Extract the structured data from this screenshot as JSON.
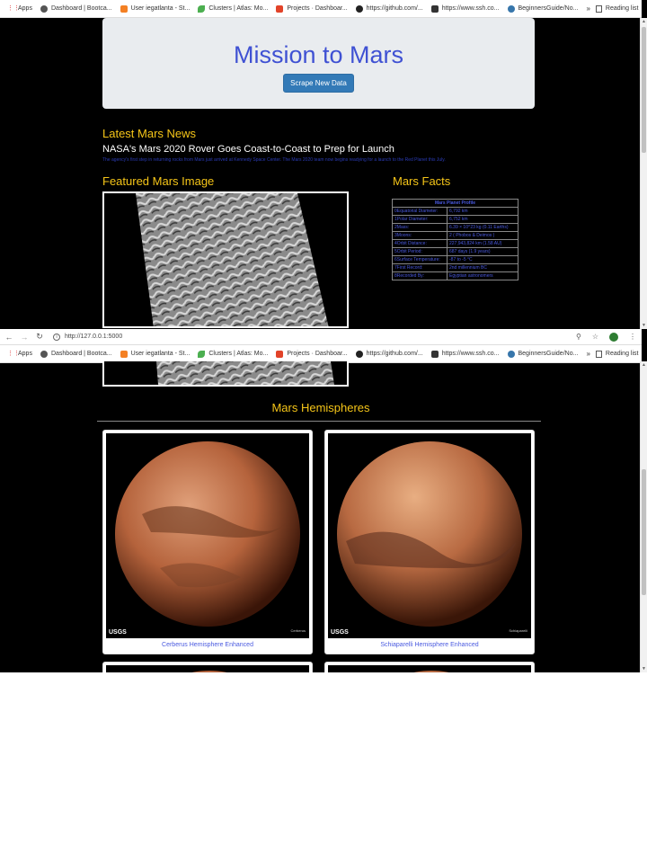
{
  "bookmarks": {
    "items": [
      {
        "label": "Apps",
        "icon": "apps-grid-icon"
      },
      {
        "label": "Dashboard | Bootca...",
        "icon": "globe-icon"
      },
      {
        "label": "User iegatlanta - St...",
        "icon": "stackoverflow-icon"
      },
      {
        "label": "Clusters | Atlas: Mo...",
        "icon": "mongodb-leaf-icon"
      },
      {
        "label": "Projects · Dashboar...",
        "icon": "gitlab-icon"
      },
      {
        "label": "https://github.com/...",
        "icon": "github-icon"
      },
      {
        "label": "https://www.ssh.co...",
        "icon": "ssh-icon"
      },
      {
        "label": "BeginnersGuide/No...",
        "icon": "python-icon"
      }
    ],
    "more": "»",
    "reading_list": "Reading list"
  },
  "address_bar": {
    "url": "http://127.0.0.1:5000"
  },
  "page": {
    "title": "Mission to Mars",
    "scrape_button": "Scrape New Data",
    "news_heading": "Latest Mars News",
    "news_title": "NASA's Mars 2020 Rover Goes Coast-to-Coast to Prep for Launch",
    "news_paragraph": "The agency's first step in returning rocks from Mars just arrived at Kennedy Space Center. The Mars 2020 team now begins readying for a launch to the Red Planet this July.",
    "featured_heading": "Featured Mars Image",
    "facts_heading": "Mars Facts",
    "facts": {
      "header": "Mars Planet Profile",
      "rows": [
        {
          "idx": "0",
          "key": "Equatorial Diameter:",
          "value": "6,792 km"
        },
        {
          "idx": "1",
          "key": "Polar Diameter:",
          "value": "6,752 km"
        },
        {
          "idx": "2",
          "key": "Mass:",
          "value": "6.39 × 10^23 kg (0.11 Earths)"
        },
        {
          "idx": "3",
          "key": "Moons:",
          "value": "2 ( Phobos & Deimos )"
        },
        {
          "idx": "4",
          "key": "Orbit Distance:",
          "value": "227,943,824 km (1.58 AU)"
        },
        {
          "idx": "5",
          "key": "Orbit Period:",
          "value": "687 days (1.9 years)"
        },
        {
          "idx": "6",
          "key": "Surface Temperature:",
          "value": "-87 to -5 °C"
        },
        {
          "idx": "7",
          "key": "First Record:",
          "value": "2nd millennium BC"
        },
        {
          "idx": "8",
          "key": "Recorded By:",
          "value": "Egyptian astronomers"
        }
      ]
    },
    "hemispheres_heading": "Mars Hemispheres",
    "hemispheres": [
      {
        "title": "Cerberus Hemisphere Enhanced",
        "corner_label": "Cerberus"
      },
      {
        "title": "Schiaparelli Hemisphere Enhanced",
        "corner_label": "Schiaparelli"
      }
    ],
    "usgs_logo": "USGS"
  },
  "colors": {
    "heading": "#f5c518",
    "title": "#3f51d3",
    "link": "#4a5ae0",
    "button": "#337ab7",
    "background": "#000000"
  }
}
